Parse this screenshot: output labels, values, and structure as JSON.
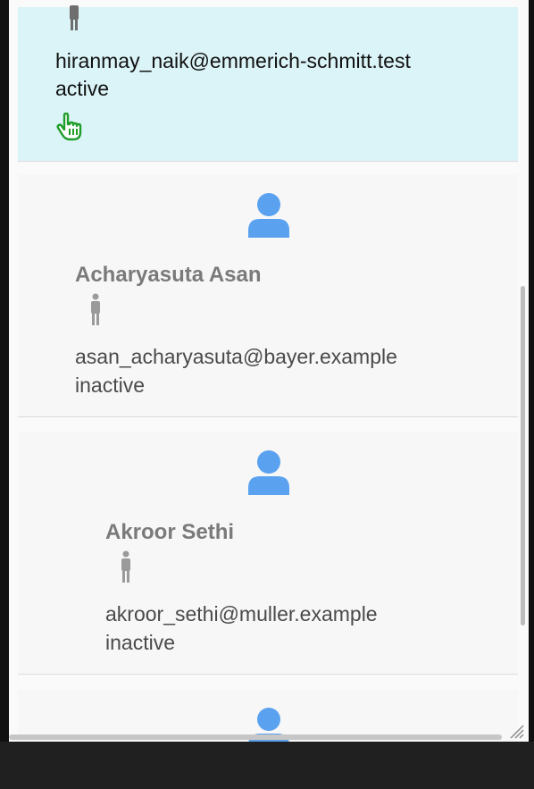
{
  "users": [
    {
      "email": "hiranmay_naik@emmerich-schmitt.test",
      "status": "active",
      "selected": true
    },
    {
      "name": "Acharyasuta Asan",
      "email": "asan_acharyasuta@bayer.example",
      "status": "inactive"
    },
    {
      "name": "Akroor Sethi",
      "email": "akroor_sethi@muller.example",
      "status": "inactive"
    }
  ],
  "colors": {
    "selected_bg": "#dbf4f8",
    "avatar": "#5aa2f0",
    "gender_icon": "#9a9a9a",
    "hand_cursor": "#1f9d2a"
  },
  "icons": {
    "avatar": "user-avatar-icon",
    "gender": "male-gender-icon",
    "cursor": "hand-pointer-icon"
  }
}
